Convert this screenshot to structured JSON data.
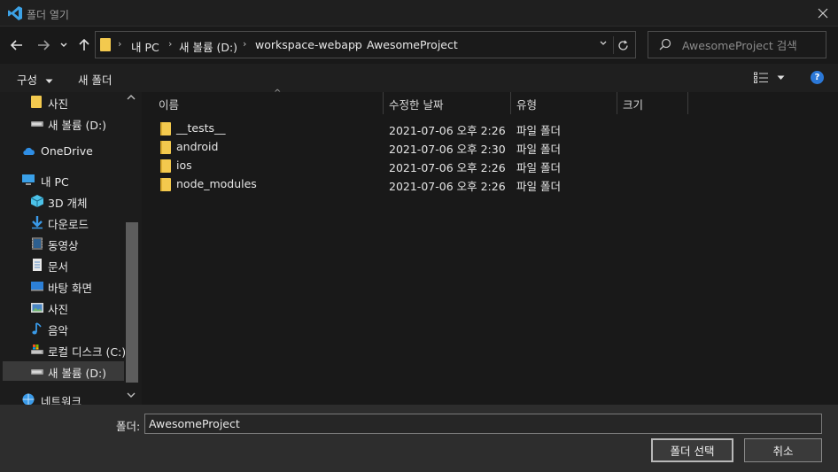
{
  "window": {
    "title": "폴더 열기"
  },
  "address": {
    "crumbs": [
      "내 PC",
      "새 볼륨 (D:)",
      "workspace-webapp",
      "AwesomeProject"
    ]
  },
  "search": {
    "placeholder": "AwesomeProject 검색"
  },
  "toolbar": {
    "organize_label": "구성",
    "new_folder_label": "새 폴더",
    "help_label": "?"
  },
  "sidebar": {
    "items": [
      {
        "label": "사진",
        "icon": "folder-icon"
      },
      {
        "label": "새 볼륨 (D:)",
        "icon": "drive-icon"
      },
      {
        "label": "OneDrive",
        "icon": "onedrive-icon"
      },
      {
        "label": "내 PC",
        "icon": "pc-icon"
      },
      {
        "label": "3D 개체",
        "icon": "3d-objects-icon"
      },
      {
        "label": "다운로드",
        "icon": "download-icon"
      },
      {
        "label": "동영상",
        "icon": "video-icon"
      },
      {
        "label": "문서",
        "icon": "document-icon"
      },
      {
        "label": "바탕 화면",
        "icon": "desktop-icon"
      },
      {
        "label": "사진",
        "icon": "pictures-icon"
      },
      {
        "label": "음악",
        "icon": "music-icon"
      },
      {
        "label": "로컬 디스크 (C:)",
        "icon": "local-disk-icon"
      },
      {
        "label": "새 볼륨 (D:)",
        "icon": "drive-icon"
      },
      {
        "label": "네트워크",
        "icon": "network-icon"
      }
    ]
  },
  "columns": {
    "name": "이름",
    "modified": "수정한 날짜",
    "type": "유형",
    "size": "크기"
  },
  "files": [
    {
      "name": "__tests__",
      "modified": "2021-07-06 오후 2:26",
      "type": "파일 폴더"
    },
    {
      "name": "android",
      "modified": "2021-07-06 오후 2:30",
      "type": "파일 폴더"
    },
    {
      "name": "ios",
      "modified": "2021-07-06 오후 2:26",
      "type": "파일 폴더"
    },
    {
      "name": "node_modules",
      "modified": "2021-07-06 오후 2:26",
      "type": "파일 폴더"
    }
  ],
  "footer": {
    "folder_label": "폴더:",
    "folder_value": "AwesomeProject",
    "select_button": "폴더 선택",
    "cancel_button": "취소"
  },
  "colors": {
    "folder": "#f3c94e",
    "accent": "#2b78d8",
    "vscode_blue": "#3ca2e6"
  }
}
